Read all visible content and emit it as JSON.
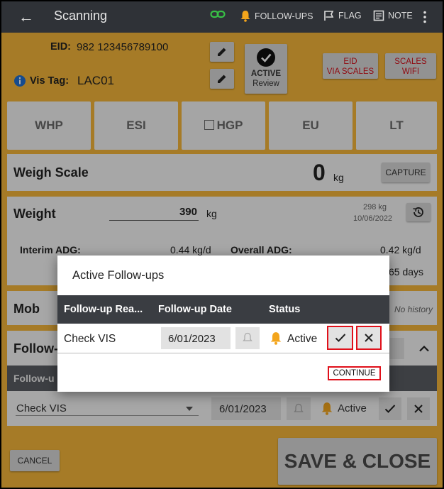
{
  "appbar": {
    "back_glyph": "←",
    "title": "Scanning",
    "followups_label": "FOLLOW-UPS",
    "flag_label": "FLAG",
    "note_label": "NOTE",
    "colors": {
      "bar": "#2f3237",
      "link": "#38c046",
      "bell": "#f3a51c"
    }
  },
  "animal": {
    "eid_label": "EID:",
    "eid_value": "982 123456789100",
    "vistag_label": "Vis Tag:",
    "vistag_value": "LAC01",
    "status_line1": "ACTIVE",
    "status_line2": "Review",
    "eid_scales_line1": "EID",
    "eid_scales_line2": "VIA SCALES",
    "scales_wifi_line1": "SCALES",
    "scales_wifi_line2": "WIFI"
  },
  "tabs": [
    "WHP",
    "ESI",
    "HGP",
    "EU",
    "LT"
  ],
  "weigh_scale": {
    "label": "Weigh Scale",
    "value": "0",
    "unit": "kg",
    "capture_label": "CAPTURE"
  },
  "weight": {
    "label": "Weight",
    "value": "390",
    "unit": "kg",
    "prev_weight": "298 kg",
    "prev_date": "10/06/2022",
    "interim_adg_label": "Interim ADG:",
    "interim_adg_value": "0.44 kg/d",
    "overall_adg_label": "Overall ADG:",
    "overall_adg_value": "0.42 kg/d",
    "days_value": "65 days"
  },
  "mob": {
    "label": "Mob",
    "history": "No history"
  },
  "followup_section": {
    "label": "Follow-",
    "subheader": "Follow-u",
    "row": {
      "reason": "Check VIS",
      "date": "6/01/2023",
      "status": "Active"
    }
  },
  "footer": {
    "cancel_label": "CANCEL",
    "save_label": "SAVE & CLOSE"
  },
  "dialog": {
    "title": "Active Follow-ups",
    "columns": [
      "Follow-up Rea...",
      "Follow-up Date",
      "Status"
    ],
    "row": {
      "reason": "Check VIS",
      "date": "6/01/2023",
      "status": "Active"
    },
    "continue_label": "CONTINUE",
    "highlight_color": "#e0101a"
  }
}
